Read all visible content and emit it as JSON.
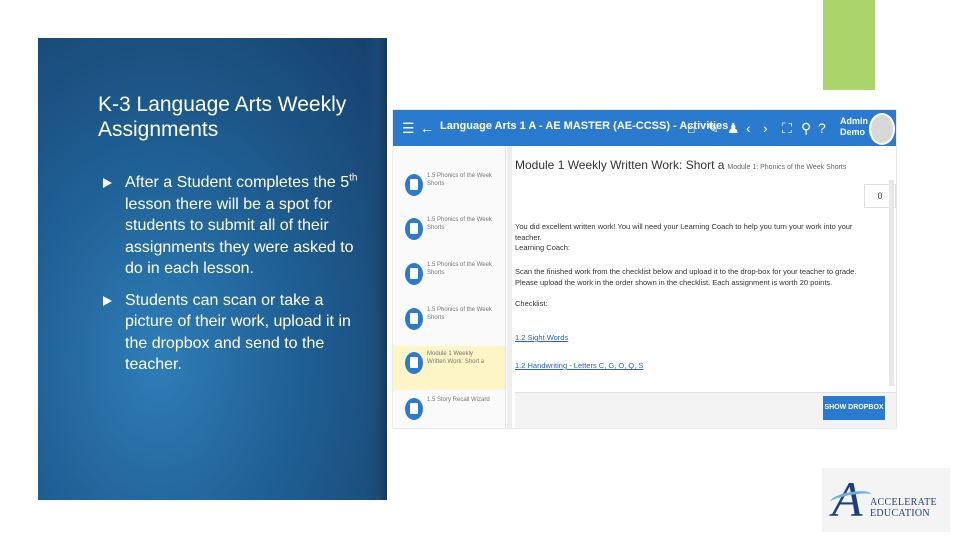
{
  "slide": {
    "title": "K-3 Language Arts Weekly Assignments",
    "bullets": [
      {
        "pre": "After a Student completes the 5",
        "sup": "th",
        "post": " lesson there will be a spot for students to submit all of their assignments they were asked to do in each lesson."
      },
      {
        "pre": "Students can scan or take a picture of their work, upload it in the dropbox and send to the teacher.",
        "sup": "",
        "post": ""
      }
    ]
  },
  "app": {
    "title": "Language Arts 1 A - AE MASTER (AE-CCSS) - Activities",
    "user_line1": "Admin",
    "user_line2": "Demo",
    "icons": [
      "menu-icon",
      "back-arrow-icon",
      "home-icon",
      "edit-icon",
      "people-icon",
      "chevron-left-icon",
      "chevron-right-icon",
      "expand-icon",
      "search-icon",
      "help-icon"
    ]
  },
  "sidebar": {
    "items": [
      {
        "label": "1.5 Phonics of the Week Shorts"
      },
      {
        "label": "1.5 Phonics of the Week Shorts"
      },
      {
        "label": "1.5 Phonics of the Week Shorts"
      },
      {
        "label": "1.5 Phonics of the Week Shorts"
      },
      {
        "label": "Module 1 Weekly Written Work: Short a"
      },
      {
        "label": "1.5 Story Recall Wizard"
      }
    ]
  },
  "main": {
    "title": "Module 1 Weekly Written Work: Short a",
    "subtitle": "Module 1: Phonics of the Week Shorts",
    "zoom_value": "0",
    "intro": "You did excellent written work! You will need your Learning Coach to help you turn your work into your teacher.",
    "coach_heading": "Learning Coach:",
    "coach_text": "Scan the finished work from the checklist below and upload it to the drop-box for your teacher to grade. Please upload the work in the order shown in the checklist. Each assignment is worth 20 points.",
    "checklist_heading": "Checklist:",
    "links": [
      "1.2 Sight Words",
      "1.2 Handwriting - Letters C, G, O, Q, S"
    ],
    "dropbox_button": "SHOW DROPBOX"
  },
  "logo": {
    "line1": "ACCELERATE",
    "line2": "EDUCATION"
  },
  "colors": {
    "appbar": "#2a7ad0",
    "accent_green": "#a9d56a",
    "panel_blue": "#1f5f93",
    "active_item": "#fdf5c6"
  }
}
